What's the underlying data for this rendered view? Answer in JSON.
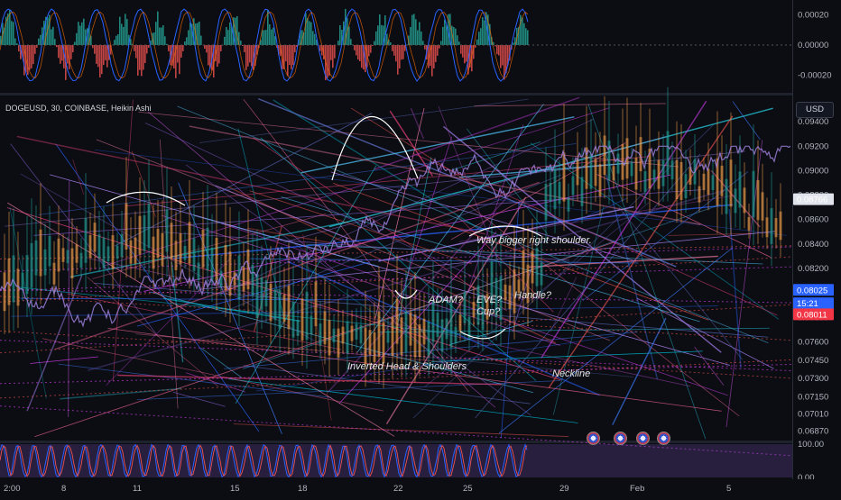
{
  "chart_data": [
    {
      "type": "bar",
      "pane": "macd",
      "title": "",
      "y_ticks": [
        "0.00020",
        "0.00000",
        "-0.00020"
      ],
      "ylim": [
        -0.0003,
        0.0003
      ],
      "colors": {
        "positive": "#26a69a",
        "negative": "#ef5350",
        "macd": "#2962ff",
        "signal": "#ff6d00"
      }
    },
    {
      "type": "line",
      "pane": "main",
      "title": "DOGEUSD, 30, COINBASE, Heikin Ashi",
      "currency_button": "USD",
      "y_ticks": [
        "0.09400",
        "0.09200",
        "0.09000",
        "0.08800",
        "0.08600",
        "0.08400",
        "0.08200",
        "0.07800",
        "0.07600",
        "0.07450",
        "0.07300",
        "0.07150",
        "0.07010",
        "0.06870"
      ],
      "ylim": [
        0.068,
        0.096
      ],
      "x_ticks": [
        "2:00",
        "8",
        "11",
        "15",
        "18",
        "22",
        "25",
        "29",
        "Feb",
        "5"
      ],
      "price_tags": [
        {
          "label": "0.08766",
          "value": 0.08766,
          "bg": "#e0e3eb",
          "fg": "#131722"
        },
        {
          "label": "0.08025",
          "value": 0.08025,
          "bg": "#2962ff",
          "fg": "#ffffff"
        },
        {
          "label": "15:21",
          "value": 0.07915,
          "bg": "#2962ff",
          "fg": "#ffffff"
        },
        {
          "label": "0.08011",
          "value": 0.07825,
          "bg": "#f23645",
          "fg": "#ffffff"
        }
      ],
      "annotations": [
        "Way bigger right shoulder.",
        "ADAM?",
        "EVE?",
        "Cup?",
        "Handle?",
        "Inverted Head & Shoulders",
        "Neckline"
      ],
      "colors": {
        "up": "#26a69a",
        "down": "#ef5350",
        "price_line": "#9c7fd9",
        "orange": "#f7a34b"
      }
    },
    {
      "type": "line",
      "pane": "stoch_rsi",
      "title": "",
      "y_ticks": [
        "100.00",
        "0.00"
      ],
      "ylim": [
        0,
        100
      ],
      "colors": {
        "k": "#2962ff",
        "d": "#ef5350",
        "band": "#7e57c2"
      }
    }
  ]
}
